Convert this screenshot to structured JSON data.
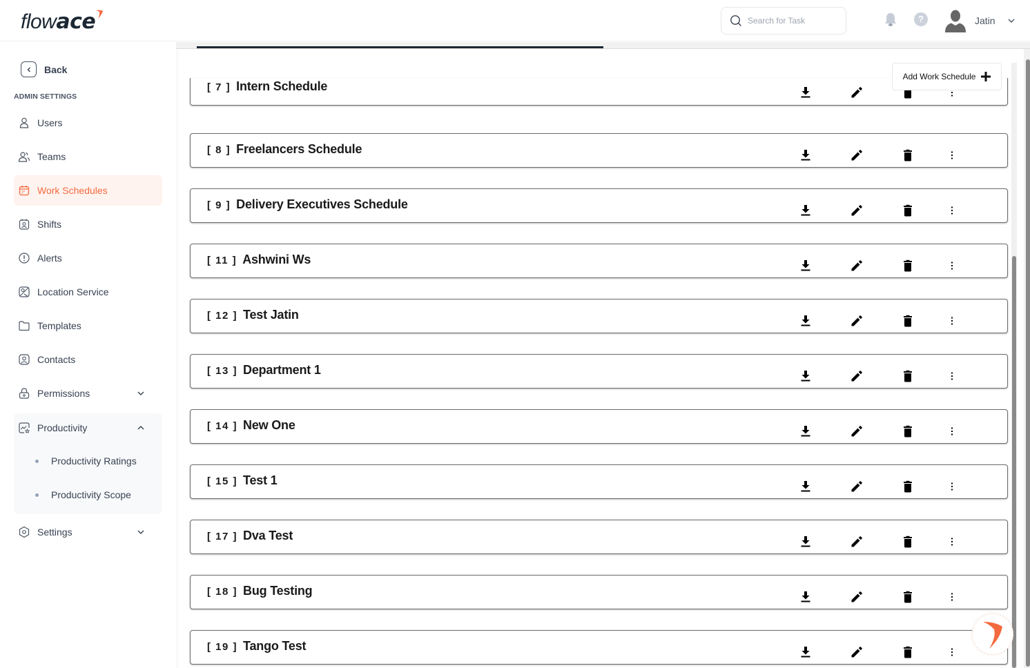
{
  "app": {
    "logo_prefix": "flow",
    "logo_suffix": "ace",
    "brand_color": "#f46a3f"
  },
  "header": {
    "search_placeholder": "Search for Task",
    "search_value": "",
    "user_name": "Jatin",
    "icons": [
      "search-icon",
      "bell-icon",
      "help-icon",
      "avatar",
      "chevron-down-icon"
    ]
  },
  "sidebar": {
    "back_label": "Back",
    "section_label": "ADMIN SETTINGS",
    "items": [
      {
        "label": "Users",
        "icon": "user-icon"
      },
      {
        "label": "Teams",
        "icon": "team-icon"
      },
      {
        "label": "Work Schedules",
        "icon": "calendar-icon",
        "active": true
      },
      {
        "label": "Shifts",
        "icon": "shift-icon"
      },
      {
        "label": "Alerts",
        "icon": "alert-icon"
      },
      {
        "label": "Location Service",
        "icon": "location-icon"
      },
      {
        "label": "Templates",
        "icon": "folder-icon"
      },
      {
        "label": "Contacts",
        "icon": "contact-icon"
      },
      {
        "label": "Permissions",
        "icon": "lock-icon",
        "expandable": true,
        "expanded": false
      },
      {
        "label": "Productivity",
        "icon": "productivity-icon",
        "expandable": true,
        "expanded": true
      },
      {
        "label": "Settings",
        "icon": "settings-icon",
        "expandable": true,
        "expanded": false
      }
    ],
    "productivity_children": [
      {
        "label": "Productivity Ratings"
      },
      {
        "label": "Productivity Scope"
      }
    ]
  },
  "main": {
    "add_button_label": "Add Work Schedule",
    "schedules": [
      {
        "id": "[ 7 ]",
        "name": "Intern Schedule"
      },
      {
        "id": "[ 8 ]",
        "name": "Freelancers Schedule"
      },
      {
        "id": "[ 9 ]",
        "name": "Delivery Executives Schedule"
      },
      {
        "id": "[ 11 ]",
        "name": "Ashwini Ws"
      },
      {
        "id": "[ 12 ]",
        "name": "Test Jatin"
      },
      {
        "id": "[ 13 ]",
        "name": "Department 1"
      },
      {
        "id": "[ 14 ]",
        "name": "New One"
      },
      {
        "id": "[ 15 ]",
        "name": "Test 1"
      },
      {
        "id": "[ 17 ]",
        "name": "Dva Test"
      },
      {
        "id": "[ 18 ]",
        "name": "Bug Testing"
      },
      {
        "id": "[ 19 ]",
        "name": "Tango Test"
      }
    ],
    "row_actions": [
      "download-icon",
      "edit-icon",
      "delete-icon",
      "more-vertical-icon"
    ]
  }
}
